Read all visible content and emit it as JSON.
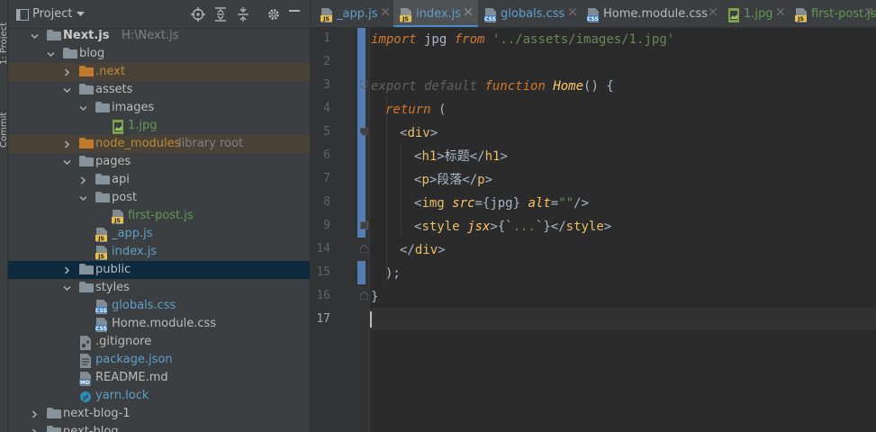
{
  "side_strip": {
    "project_label": "1: Project",
    "commit_label": "Commit"
  },
  "panel": {
    "title": "Project"
  },
  "tree": [
    {
      "label": "Next.js",
      "hint": "H:\\Next.js",
      "kind": "folder",
      "state": "open"
    },
    {
      "label": "blog",
      "kind": "folder",
      "state": "open"
    },
    {
      "label": ".next",
      "kind": "folder-orange",
      "state": "closed"
    },
    {
      "label": "assets",
      "kind": "folder",
      "state": "open"
    },
    {
      "label": "images",
      "kind": "folder",
      "state": "open"
    },
    {
      "label": "1.jpg",
      "kind": "jpg"
    },
    {
      "label": "node_modules",
      "hint": "library root",
      "kind": "folder-orange",
      "state": "closed"
    },
    {
      "label": "pages",
      "kind": "folder",
      "state": "open"
    },
    {
      "label": "api",
      "kind": "folder",
      "state": "closed"
    },
    {
      "label": "post",
      "kind": "folder",
      "state": "open"
    },
    {
      "label": "first-post.js",
      "kind": "js"
    },
    {
      "label": "_app.js",
      "kind": "js"
    },
    {
      "label": "index.js",
      "kind": "js"
    },
    {
      "label": "public",
      "kind": "folder",
      "state": "closed",
      "selected": true
    },
    {
      "label": "styles",
      "kind": "folder",
      "state": "open"
    },
    {
      "label": "globals.css",
      "kind": "css"
    },
    {
      "label": "Home.module.css",
      "kind": "css"
    },
    {
      "label": ".gitignore",
      "kind": "git"
    },
    {
      "label": "package.json",
      "kind": "json"
    },
    {
      "label": "README.md",
      "kind": "md"
    },
    {
      "label": "yarn.lock",
      "kind": "yarn"
    },
    {
      "label": "next-blog-1",
      "kind": "folder",
      "state": "closed"
    },
    {
      "label": "next-blog",
      "kind": "folder",
      "state": "closed"
    }
  ],
  "tabs": [
    {
      "label": "_app.js",
      "kind": "js",
      "active": false
    },
    {
      "label": "index.js",
      "kind": "js",
      "active": true
    },
    {
      "label": "globals.css",
      "kind": "css",
      "active": false
    },
    {
      "label": "Home.module.css",
      "kind": "css",
      "active": false
    },
    {
      "label": "1.jpg",
      "kind": "jpg",
      "active": false
    },
    {
      "label": "first-post.js",
      "kind": "js",
      "active": false
    }
  ],
  "gutter": {
    "line_numbers": [
      "1",
      "2",
      "3",
      "4",
      "5",
      "6",
      "7",
      "8",
      "9",
      "14",
      "15",
      "16",
      "17"
    ]
  },
  "code": {
    "l1": {
      "kw1": "import",
      "id": " jpg ",
      "kw2": "from",
      "sp": " ",
      "str": "'../assets/images/1.jpg'"
    },
    "l3": {
      "kw1": "export default",
      "sp": " ",
      "kw2": "function",
      "sp2": " ",
      "fn": "Home",
      "rest": "() {"
    },
    "l4": {
      "kw": "return",
      "rest": " ("
    },
    "l5": {
      "open": "<",
      "tag": "div",
      "close": ">"
    },
    "l6": {
      "open": "<",
      "tag": "h1",
      "mid": ">标题</",
      "tag2": "h1",
      "close": ">"
    },
    "l7": {
      "open": "<",
      "tag": "p",
      "mid": ">段落</",
      "tag2": "p",
      "close": ">"
    },
    "l8": {
      "open": "<",
      "tag": "img",
      "sp": " ",
      "attr1": "src",
      "v1": "={jpg} ",
      "attr2": "alt",
      "eq": "=",
      "str": "\"\"",
      "close": "/>"
    },
    "l9": {
      "open": "<",
      "tag": "style",
      "sp": " ",
      "attr": "jsx",
      "mid": ">{`",
      "dots": "...",
      "mid2": "`}</",
      "tag2": "style",
      "close": ">"
    },
    "l14": {
      "open": "</",
      "tag": "div",
      "close": ">"
    },
    "l15": {
      "text": ");"
    },
    "l16": {
      "text": "}"
    }
  }
}
